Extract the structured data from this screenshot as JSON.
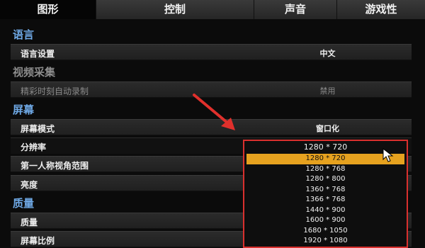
{
  "tabs": [
    {
      "label": "图形",
      "active": true
    },
    {
      "label": "控制",
      "active": false
    },
    {
      "label": "声音",
      "active": false
    },
    {
      "label": "游戏性",
      "active": false
    }
  ],
  "sections": {
    "language": "语言",
    "video_capture": "视频采集",
    "screen": "屏幕",
    "quality": "质量"
  },
  "rows": {
    "language_setting": {
      "label": "语言设置",
      "value": "中文"
    },
    "highlight_record": {
      "label": "精彩时刻自动录制",
      "value": "禁用"
    },
    "screen_mode": {
      "label": "屏幕模式",
      "value": "窗口化"
    },
    "resolution": {
      "label": "分辨率",
      "value": "1280 * 720"
    },
    "fov": {
      "label": "第一人称视角范围"
    },
    "brightness": {
      "label": "亮度"
    },
    "quality": {
      "label": "质量"
    },
    "aspect_ratio": {
      "label": "屏幕比例"
    }
  },
  "resolution_dropdown": {
    "current": "1280 * 720",
    "options": [
      "1280 * 720",
      "1280 * 768",
      "1280 * 800",
      "1360 * 768",
      "1366 * 768",
      "1440 * 900",
      "1600 * 900",
      "1680 * 1050",
      "1920 * 1080"
    ],
    "selected_index": 0
  },
  "colors": {
    "accent": "#e6a21f",
    "highlight_border": "#d9302e",
    "section_text": "#6fa9e6"
  }
}
